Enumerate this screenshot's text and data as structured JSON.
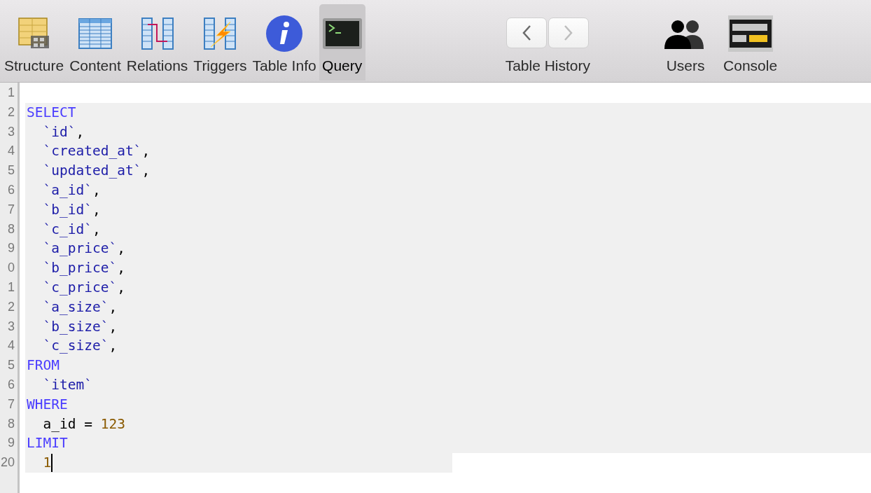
{
  "toolbar": {
    "items": [
      {
        "label": "Structure",
        "selected": false
      },
      {
        "label": "Content",
        "selected": false
      },
      {
        "label": "Relations",
        "selected": false
      },
      {
        "label": "Triggers",
        "selected": false
      },
      {
        "label": "Table Info",
        "selected": false
      },
      {
        "label": "Query",
        "selected": true
      }
    ],
    "history": {
      "label": "Table History",
      "back_disabled": false,
      "forward_disabled": true
    },
    "right_items": [
      {
        "label": "Users"
      },
      {
        "label": "Console"
      }
    ]
  },
  "editor": {
    "lines": [
      {
        "number": "1",
        "highlighted": false
      },
      {
        "number": "2",
        "highlighted": true,
        "tokens": [
          {
            "kind": "keyword",
            "text": "SELECT"
          }
        ]
      },
      {
        "number": "3",
        "highlighted": true,
        "tokens": [
          {
            "kind": "identifier",
            "text": "  `id`"
          },
          {
            "kind": "plain",
            "text": ","
          }
        ]
      },
      {
        "number": "4",
        "highlighted": true,
        "tokens": [
          {
            "kind": "identifier",
            "text": "  `created_at`"
          },
          {
            "kind": "plain",
            "text": ","
          }
        ]
      },
      {
        "number": "5",
        "highlighted": true,
        "tokens": [
          {
            "kind": "identifier",
            "text": "  `updated_at`"
          },
          {
            "kind": "plain",
            "text": ","
          }
        ]
      },
      {
        "number": "6",
        "highlighted": true,
        "tokens": [
          {
            "kind": "identifier",
            "text": "  `a_id`"
          },
          {
            "kind": "plain",
            "text": ","
          }
        ]
      },
      {
        "number": "7",
        "highlighted": true,
        "tokens": [
          {
            "kind": "identifier",
            "text": "  `b_id`"
          },
          {
            "kind": "plain",
            "text": ","
          }
        ]
      },
      {
        "number": "8",
        "highlighted": true,
        "tokens": [
          {
            "kind": "identifier",
            "text": "  `c_id`"
          },
          {
            "kind": "plain",
            "text": ","
          }
        ]
      },
      {
        "number": "9",
        "highlighted": true,
        "tokens": [
          {
            "kind": "identifier",
            "text": "  `a_price`"
          },
          {
            "kind": "plain",
            "text": ","
          }
        ]
      },
      {
        "number": "0",
        "highlighted": true,
        "tokens": [
          {
            "kind": "identifier",
            "text": "  `b_price`"
          },
          {
            "kind": "plain",
            "text": ","
          }
        ]
      },
      {
        "number": "1",
        "highlighted": true,
        "tokens": [
          {
            "kind": "identifier",
            "text": "  `c_price`"
          },
          {
            "kind": "plain",
            "text": ","
          }
        ]
      },
      {
        "number": "2",
        "highlighted": true,
        "tokens": [
          {
            "kind": "identifier",
            "text": "  `a_size`"
          },
          {
            "kind": "plain",
            "text": ","
          }
        ]
      },
      {
        "number": "3",
        "highlighted": true,
        "tokens": [
          {
            "kind": "identifier",
            "text": "  `b_size`"
          },
          {
            "kind": "plain",
            "text": ","
          }
        ]
      },
      {
        "number": "4",
        "highlighted": true,
        "tokens": [
          {
            "kind": "identifier",
            "text": "  `c_size`"
          },
          {
            "kind": "plain",
            "text": ","
          }
        ]
      },
      {
        "number": "5",
        "highlighted": true,
        "tokens": [
          {
            "kind": "keyword",
            "text": "FROM"
          }
        ]
      },
      {
        "number": "6",
        "highlighted": true,
        "tokens": [
          {
            "kind": "identifier",
            "text": "  `item`"
          }
        ]
      },
      {
        "number": "7",
        "highlighted": true,
        "tokens": [
          {
            "kind": "keyword",
            "text": "WHERE"
          }
        ]
      },
      {
        "number": "8",
        "highlighted": true,
        "tokens": [
          {
            "kind": "plain",
            "text": "  a_id = "
          },
          {
            "kind": "number",
            "text": "123"
          }
        ]
      },
      {
        "number": "9",
        "highlighted": true,
        "tokens": [
          {
            "kind": "keyword",
            "text": "LIMIT"
          }
        ]
      },
      {
        "number": "20",
        "highlighted": true,
        "partial": true,
        "cursor": true,
        "tokens": [
          {
            "kind": "number",
            "text": "  1"
          }
        ]
      }
    ]
  }
}
